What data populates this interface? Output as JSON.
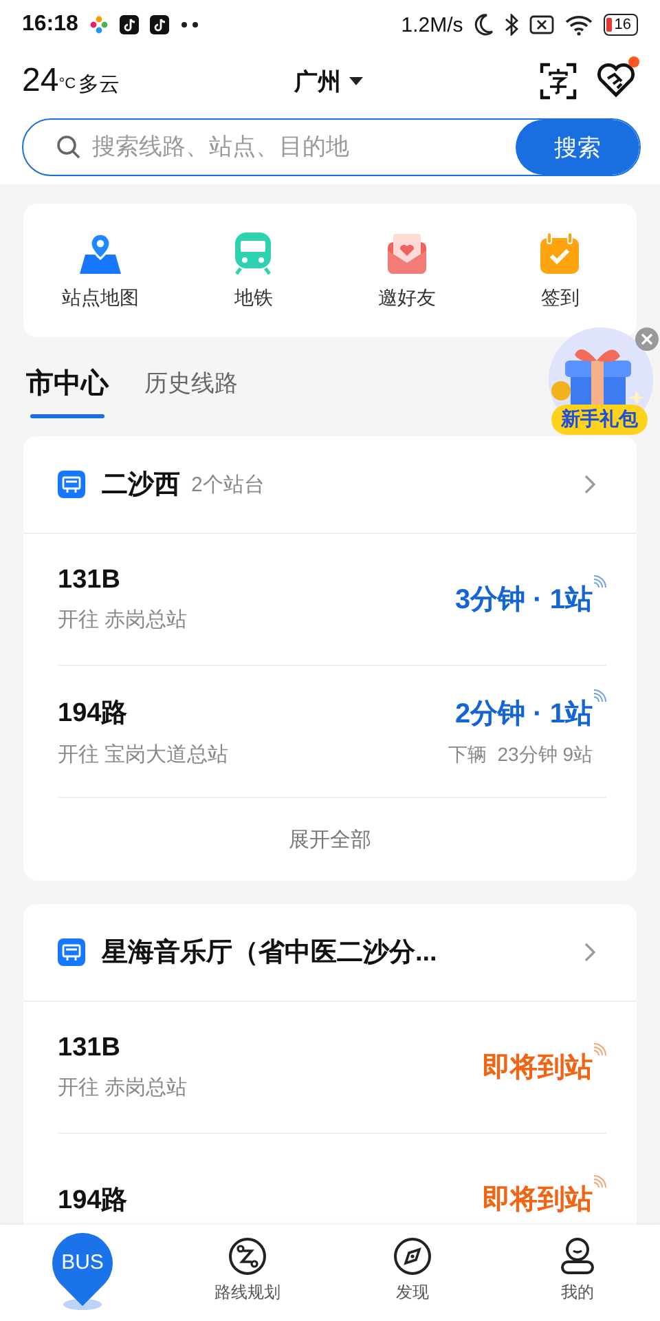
{
  "status_bar": {
    "time": "16:18",
    "speed": "1.2M/s",
    "battery": "16"
  },
  "header": {
    "temperature": "24",
    "unit": "°C",
    "weather": "多云",
    "city": "广州",
    "notification_dot": true
  },
  "search": {
    "placeholder": "搜索线路、站点、目的地",
    "button": "搜索"
  },
  "shortcuts": [
    {
      "label": "站点地图",
      "kind": "map"
    },
    {
      "label": "地铁",
      "kind": "metro"
    },
    {
      "label": "邀好友",
      "kind": "invite"
    },
    {
      "label": "签到",
      "kind": "checkin"
    }
  ],
  "tabs": [
    {
      "label": "市中心",
      "selected": true
    },
    {
      "label": "历史线路",
      "selected": false
    }
  ],
  "promo": {
    "label": "新手礼包"
  },
  "stations": [
    {
      "name": "二沙西",
      "count": "2个站台",
      "expand": "展开全部",
      "routes": [
        {
          "route": "131B",
          "direction": "开往 赤岗总站",
          "kind": "eta",
          "arrival": "3分钟 · 1站"
        },
        {
          "route": "194路",
          "direction": "开往 宝岗大道总站",
          "kind": "eta",
          "arrival": "2分钟 · 1站",
          "next": "下辆  23分钟 9站"
        }
      ]
    },
    {
      "name": "星海音乐厅（省中医二沙分...",
      "routes": [
        {
          "route": "131B",
          "direction": "开往 赤岗总站",
          "kind": "arriving",
          "arrival": "即将到站"
        },
        {
          "route": "194路",
          "kind": "arriving",
          "arrival": "即将到站"
        }
      ]
    }
  ],
  "nav": [
    {
      "label": "BUS",
      "kind": "bus",
      "selected": true
    },
    {
      "label": "路线规划",
      "kind": "route",
      "selected": false
    },
    {
      "label": "发现",
      "kind": "discover",
      "selected": false
    },
    {
      "label": "我的",
      "kind": "me",
      "selected": false
    }
  ]
}
